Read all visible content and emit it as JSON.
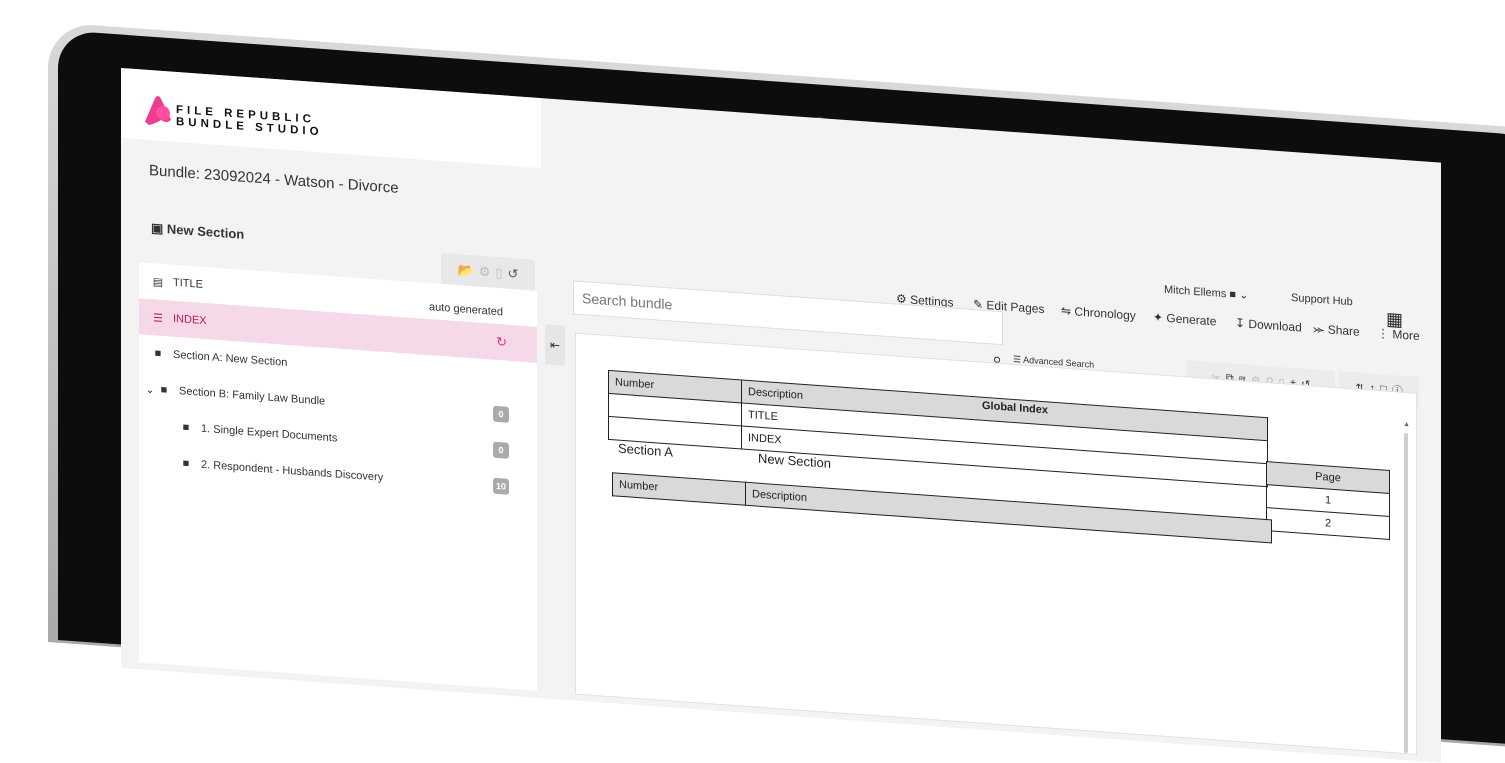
{
  "app": {
    "logo_line1": "FILE REPUBLIC",
    "logo_line2": "BUNDLE STUDIO",
    "accent": "#e0337a"
  },
  "bundle_title": "Bundle: 23092024 - Watson - Divorce",
  "header": {
    "user": "Mitch Ellems",
    "support": "Support Hub"
  },
  "sidebar": {
    "new_section": "New Section",
    "items": [
      {
        "label": "TITLE",
        "icon": "file-icon"
      },
      {
        "label": "INDEX",
        "icon": "list-icon",
        "note": "auto generated"
      },
      {
        "label": "Section A: New Section",
        "icon": "folder-icon"
      },
      {
        "label": "Section B: Family Law Bundle",
        "icon": "folder-open-icon",
        "badge": "0"
      },
      {
        "label": "1. Single Expert Documents",
        "icon": "folder-icon",
        "badge": "0"
      },
      {
        "label": "2. Respondent - Husbands Discovery",
        "icon": "folder-icon",
        "badge": "10"
      }
    ]
  },
  "toolbar": {
    "settings": "Settings",
    "edit_pages": "Edit Pages",
    "chronology": "Chronology",
    "generate": "Generate",
    "download": "Download",
    "share": "Share",
    "more": "More"
  },
  "search": {
    "placeholder": "Search bundle",
    "advanced": "Advanced Search"
  },
  "document": {
    "global_index": "Global Index",
    "header_number": "Number",
    "header_description": "Description",
    "header_page": "Page",
    "rows": [
      {
        "description": "TITLE",
        "page": "1"
      },
      {
        "description": "INDEX",
        "page": "2"
      }
    ],
    "section_a": {
      "label": "Section A",
      "title": "New Section"
    }
  }
}
